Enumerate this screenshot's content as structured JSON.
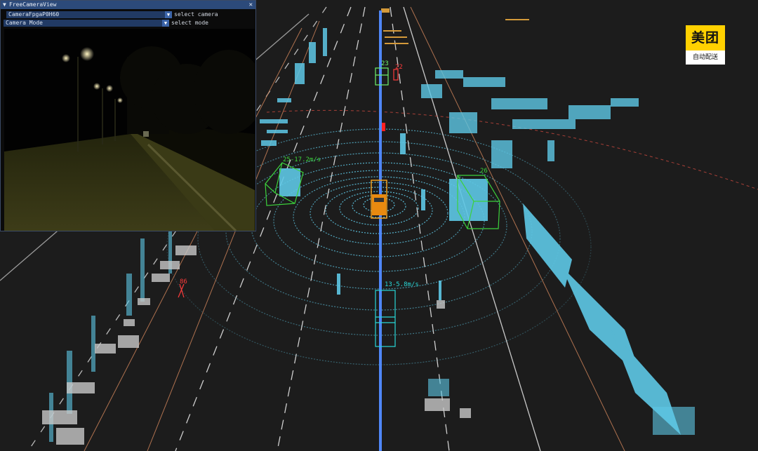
{
  "window": {
    "title": "FreeCameraView",
    "collapse_icon": "triangle-down-icon",
    "close_icon": "close-icon",
    "close_glyph": "✕"
  },
  "camera_select": {
    "value": "CameraFpgaP0H60",
    "label": "select camera",
    "icon": "dropdown-arrow-icon"
  },
  "mode_select": {
    "value": "Camera Mode",
    "label": "select mode",
    "icon": "dropdown-arrow-icon"
  },
  "logo": {
    "brand": "美团",
    "subtitle": "自动配送",
    "color": "#ffd100"
  },
  "objects": [
    {
      "id": "car-ahead",
      "label": "23",
      "color": "#6cf06c"
    },
    {
      "id": "ped-ahead",
      "label": "22",
      "color": "#ff3b3b"
    },
    {
      "id": "car-left",
      "label": "25-17.2m/s",
      "color": "#3cd23c"
    },
    {
      "id": "car-right",
      "label": "26",
      "color": "#3cd23c"
    },
    {
      "id": "car-behind",
      "label": "13-5.8m/s",
      "color": "#28d7d7"
    },
    {
      "id": "ped-left",
      "label": "86",
      "color": "#ff3b3b"
    }
  ],
  "colors": {
    "background": "#1c1c1c",
    "point_cloud": "#5ec8e6",
    "lane": "#cfcfcf",
    "path": "#4f86f7",
    "ego": "#f0a020"
  }
}
